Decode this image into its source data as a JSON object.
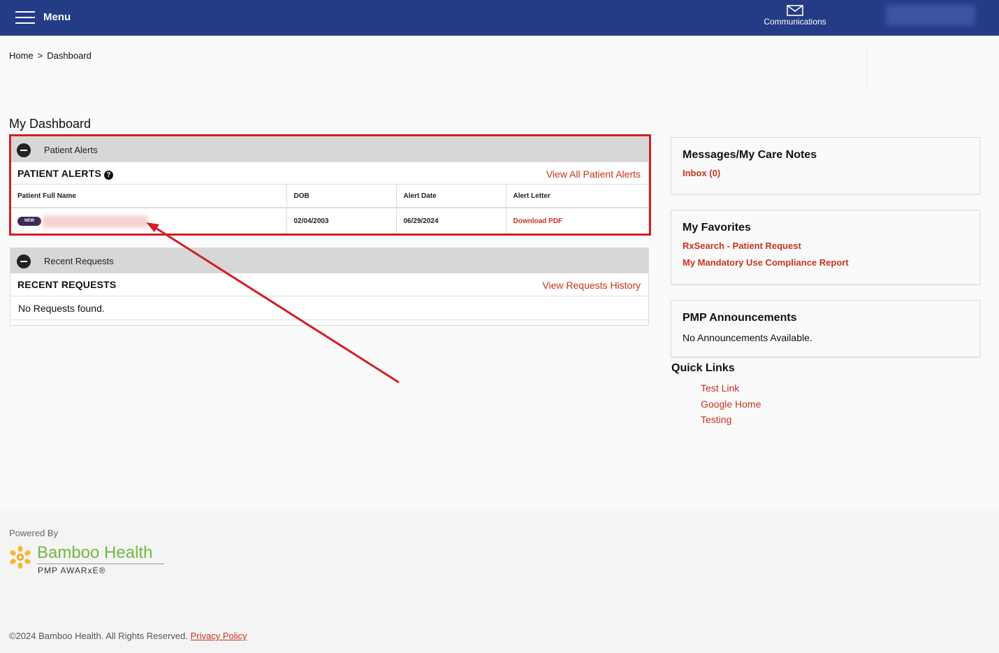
{
  "header": {
    "menu_label": "Menu",
    "communications_label": "Communications"
  },
  "breadcrumb": {
    "home": "Home",
    "separator": ">",
    "current": "Dashboard"
  },
  "page_title": "My Dashboard",
  "patient_alerts": {
    "panel_label": "Patient Alerts",
    "title": "PATIENT ALERTS",
    "help_icon": "?",
    "view_all_label": "View All Patient Alerts",
    "columns": [
      "Patient Full Name",
      "DOB",
      "Alert Date",
      "Alert Letter"
    ],
    "rows": [
      {
        "badge": "NEW",
        "name": "",
        "dob": "02/04/2003",
        "alert_date": "06/29/2024",
        "letter_link": "Download PDF"
      }
    ]
  },
  "recent_requests": {
    "panel_label": "Recent Requests",
    "title": "RECENT REQUESTS",
    "view_history_label": "View Requests History",
    "empty_text": "No Requests found."
  },
  "messages": {
    "title": "Messages/My Care Notes",
    "inbox_label": "Inbox (0)"
  },
  "favorites": {
    "title": "My Favorites",
    "links": [
      "RxSearch - Patient Request",
      "My Mandatory Use Compliance Report"
    ]
  },
  "announcements": {
    "title": "PMP Announcements",
    "empty_text": "No Announcements Available."
  },
  "quick_links": {
    "title": "Quick Links",
    "links": [
      "Test Link",
      "Google Home",
      "Testing"
    ]
  },
  "footer": {
    "powered_by": "Powered By",
    "brand_name": "Bamboo Health",
    "brand_sub": "PMP AWARxE®",
    "copyright": "©2024 Bamboo Health. All Rights Reserved.",
    "privacy_label": "Privacy Policy"
  },
  "colors": {
    "header_bg": "#243b86",
    "link_red": "#c8321f",
    "highlight_red": "#d21e25",
    "brand_green": "#72b83e",
    "badge_purple": "#3a2a55"
  },
  "icons": [
    "menu-icon",
    "mail-icon",
    "collapse-icon",
    "help-icon",
    "bamboo-logo-icon"
  ]
}
